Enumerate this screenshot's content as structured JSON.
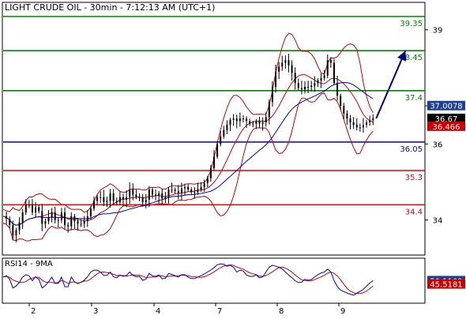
{
  "header": {
    "title": "LIGHT CRUDE OIL - 30min - 7:12:13 AM (UTC+1)"
  },
  "rsi_panel": {
    "title": "RSI14 - 9MA"
  },
  "colors": {
    "background": "#ffffff",
    "frame": "#000000",
    "candles": "#000000",
    "bollinger": "#cc0000",
    "moving_average": "#0000cc",
    "arrow": "#00007a",
    "support": "#ee0000",
    "resistance": "#008800",
    "pivot": "#0000cc",
    "box_blue": "#1c3f94",
    "box_black": "#000000",
    "box_red": "#cc0000"
  },
  "chart_data": [
    {
      "type": "candlestick",
      "title": "LIGHT CRUDE OIL - 30min - 7:12:13 AM (UTC+1)",
      "x_tick_labels": [
        "2",
        "3",
        "4",
        "7",
        "8",
        "9"
      ],
      "y_ticks": [
        34,
        36,
        37,
        39
      ],
      "y_tick_labels": [
        "34",
        "36",
        "37",
        "39"
      ],
      "ylim": [
        33.1,
        39.7
      ],
      "grid": false,
      "horizontal_levels": [
        {
          "label": "39.35",
          "value": 39.35,
          "color": "#008800"
        },
        {
          "label": "38.45",
          "value": 38.45,
          "color": "#008800"
        },
        {
          "label": "37.4",
          "value": 37.4,
          "color": "#008800"
        },
        {
          "label": "36.05",
          "value": 36.05,
          "color": "#0000cc"
        },
        {
          "label": "35.3",
          "value": 35.3,
          "color": "#ee0000"
        },
        {
          "label": "34.4",
          "value": 34.4,
          "color": "#ee0000"
        }
      ],
      "value_boxes": [
        {
          "label": "37.0078",
          "value": 37.0078,
          "color": "#1c3f94"
        },
        {
          "label": "36.67",
          "value": 36.67,
          "color": "#000000"
        },
        {
          "label": "36.466",
          "value": 36.466,
          "color": "#cc0000"
        }
      ],
      "price_path": [
        [
          0,
          34.1
        ],
        [
          3,
          34.0
        ],
        [
          6,
          33.6
        ],
        [
          9,
          33.8
        ],
        [
          12,
          34.2
        ],
        [
          15,
          34.5
        ],
        [
          18,
          34.2
        ],
        [
          21,
          34.4
        ],
        [
          24,
          33.9
        ],
        [
          27,
          34.0
        ],
        [
          30,
          34.2
        ],
        [
          33,
          33.9
        ],
        [
          36,
          34.2
        ],
        [
          39,
          33.7
        ],
        [
          42,
          34.1
        ],
        [
          45,
          33.9
        ],
        [
          48,
          33.9
        ],
        [
          51,
          34.0
        ],
        [
          54,
          34.3
        ],
        [
          57,
          34.6
        ],
        [
          60,
          34.6
        ],
        [
          63,
          34.4
        ],
        [
          66,
          34.7
        ],
        [
          69,
          34.4
        ],
        [
          72,
          34.6
        ],
        [
          75,
          34.5
        ],
        [
          78,
          34.8
        ],
        [
          81,
          34.6
        ],
        [
          84,
          34.6
        ],
        [
          87,
          34.4
        ],
        [
          90,
          34.8
        ],
        [
          93,
          34.6
        ],
        [
          96,
          34.7
        ],
        [
          99,
          34.5
        ],
        [
          102,
          34.8
        ],
        [
          105,
          34.8
        ],
        [
          108,
          34.7
        ],
        [
          111,
          34.9
        ],
        [
          114,
          34.8
        ],
        [
          117,
          34.7
        ],
        [
          120,
          34.8
        ],
        [
          123,
          34.9
        ],
        [
          126,
          35.1
        ],
        [
          129,
          35.5
        ],
        [
          132,
          36.0
        ],
        [
          135,
          36.3
        ],
        [
          138,
          36.5
        ],
        [
          141,
          36.7
        ],
        [
          144,
          36.6
        ],
        [
          147,
          36.7
        ],
        [
          150,
          36.6
        ],
        [
          153,
          36.5
        ],
        [
          156,
          36.6
        ],
        [
          159,
          36.5
        ],
        [
          162,
          36.7
        ],
        [
          165,
          37.3
        ],
        [
          168,
          37.9
        ],
        [
          171,
          38.1
        ],
        [
          174,
          38.2
        ],
        [
          177,
          38.0
        ],
        [
          180,
          37.6
        ],
        [
          183,
          37.4
        ],
        [
          186,
          37.5
        ],
        [
          189,
          37.5
        ],
        [
          192,
          37.6
        ],
        [
          195,
          37.7
        ],
        [
          198,
          37.8
        ],
        [
          201,
          38.4
        ],
        [
          204,
          37.6
        ],
        [
          207,
          37.1
        ],
        [
          210,
          36.8
        ],
        [
          213,
          36.6
        ],
        [
          216,
          36.5
        ],
        [
          219,
          36.4
        ],
        [
          222,
          36.5
        ],
        [
          225,
          36.6
        ],
        [
          228,
          36.67
        ]
      ],
      "forecast_arrow": {
        "from": [
          228,
          36.67
        ],
        "to": [
          248,
          38.45
        ]
      },
      "series": [
        {
          "type": "candlestick",
          "color": "#000000"
        },
        {
          "type": "line",
          "color": "#cc0000"
        },
        {
          "type": "line",
          "color": "#0000cc"
        }
      ]
    },
    {
      "type": "line",
      "title": "RSI14 - 9MA",
      "x_tick_labels": [
        "2",
        "3",
        "4",
        "7",
        "8",
        "9"
      ],
      "ylim": [
        20,
        80
      ],
      "value_boxes": [
        {
          "label": "50.1109",
          "value": 50.1109,
          "color": "#1c3f94"
        },
        {
          "label": "45.5181",
          "value": 45.5181,
          "color": "#cc0000"
        }
      ],
      "rsi_path": [
        [
          0,
          55
        ],
        [
          3,
          58
        ],
        [
          6,
          40
        ],
        [
          9,
          44
        ],
        [
          12,
          55
        ],
        [
          15,
          60
        ],
        [
          18,
          50
        ],
        [
          21,
          58
        ],
        [
          24,
          40
        ],
        [
          27,
          45
        ],
        [
          30,
          55
        ],
        [
          33,
          42
        ],
        [
          36,
          55
        ],
        [
          39,
          35
        ],
        [
          42,
          55
        ],
        [
          45,
          45
        ],
        [
          48,
          48
        ],
        [
          51,
          52
        ],
        [
          54,
          62
        ],
        [
          57,
          66
        ],
        [
          60,
          62
        ],
        [
          63,
          55
        ],
        [
          66,
          62
        ],
        [
          69,
          52
        ],
        [
          72,
          58
        ],
        [
          75,
          55
        ],
        [
          78,
          62
        ],
        [
          81,
          55
        ],
        [
          84,
          56
        ],
        [
          87,
          48
        ],
        [
          90,
          60
        ],
        [
          93,
          55
        ],
        [
          96,
          58
        ],
        [
          99,
          50
        ],
        [
          102,
          60
        ],
        [
          105,
          58
        ],
        [
          108,
          55
        ],
        [
          111,
          60
        ],
        [
          114,
          55
        ],
        [
          117,
          52
        ],
        [
          120,
          55
        ],
        [
          123,
          58
        ],
        [
          126,
          62
        ],
        [
          129,
          66
        ],
        [
          132,
          72
        ],
        [
          135,
          74
        ],
        [
          138,
          70
        ],
        [
          141,
          72
        ],
        [
          144,
          62
        ],
        [
          147,
          66
        ],
        [
          150,
          58
        ],
        [
          153,
          55
        ],
        [
          156,
          58
        ],
        [
          159,
          52
        ],
        [
          162,
          62
        ],
        [
          165,
          72
        ],
        [
          168,
          70
        ],
        [
          171,
          68
        ],
        [
          174,
          62
        ],
        [
          177,
          56
        ],
        [
          180,
          50
        ],
        [
          183,
          46
        ],
        [
          186,
          52
        ],
        [
          189,
          50
        ],
        [
          192,
          55
        ],
        [
          195,
          60
        ],
        [
          198,
          62
        ],
        [
          201,
          68
        ],
        [
          204,
          50
        ],
        [
          207,
          38
        ],
        [
          210,
          35
        ],
        [
          213,
          32
        ],
        [
          216,
          30
        ],
        [
          219,
          34
        ],
        [
          222,
          38
        ],
        [
          225,
          45
        ],
        [
          228,
          50.1
        ]
      ],
      "series": [
        {
          "type": "line",
          "color": "#0000cc"
        },
        {
          "type": "line",
          "color": "#cc0000"
        }
      ]
    }
  ]
}
